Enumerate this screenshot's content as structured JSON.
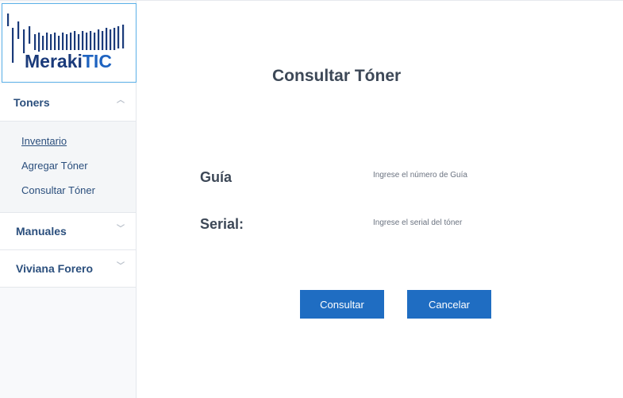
{
  "logo": {
    "text_main": "Meraki",
    "text_accent": "TIC",
    "brand_color": "#1a3a7a",
    "accent_color": "#1e63c0"
  },
  "sidebar": {
    "sections": [
      {
        "label": "Toners",
        "expanded": true,
        "items": [
          {
            "label": "Inventario",
            "active": true
          },
          {
            "label": "Agregar Tóner"
          },
          {
            "label": "Consultar Tóner"
          }
        ]
      },
      {
        "label": "Manuales",
        "expanded": false
      },
      {
        "label": "Viviana Forero",
        "expanded": false
      }
    ]
  },
  "main": {
    "title": "Consultar Tóner",
    "fields": [
      {
        "label": "Guía",
        "placeholder": "Ingrese el número de Guía",
        "value": ""
      },
      {
        "label": "Serial:",
        "placeholder": "Ingrese el serial del tóner",
        "value": ""
      }
    ],
    "buttons": {
      "submit": "Consultar",
      "cancel": "Cancelar"
    },
    "button_color": "#1f6dc2"
  }
}
